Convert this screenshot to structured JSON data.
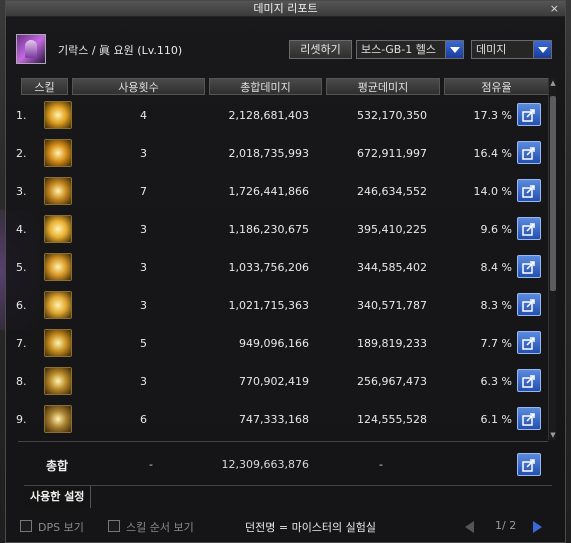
{
  "window": {
    "title": "데미지 리포트",
    "close_label": "×"
  },
  "header": {
    "character": "기락스 / 眞 요원 (Lv.110)",
    "reset_button": "리셋하기",
    "dungeon_select": "보스-GB-1 헬스",
    "metric_select": "데미지"
  },
  "columns": {
    "skill": "스킬",
    "uses": "사용횟수",
    "total": "총합데미지",
    "avg": "평균데미지",
    "share": "점유율"
  },
  "rows": [
    {
      "rank": "1.",
      "icon": "skill-icon-burst",
      "uses": "4",
      "total": "2,128,681,403",
      "avg": "532,170,350",
      "share": "17.3 %",
      "icon_color": "#e0a020"
    },
    {
      "rank": "2.",
      "icon": "skill-icon-spin",
      "uses": "3",
      "total": "2,018,735,993",
      "avg": "672,911,997",
      "share": "16.4 %",
      "icon_color": "#d89018"
    },
    {
      "rank": "3.",
      "icon": "skill-icon-blades",
      "uses": "7",
      "total": "1,726,441,866",
      "avg": "246,634,552",
      "share": "14.0 %",
      "icon_color": "#c88a20"
    },
    {
      "rank": "4.",
      "icon": "skill-icon-slash",
      "uses": "3",
      "total": "1,186,230,675",
      "avg": "395,410,225",
      "share": "9.6 %",
      "icon_color": "#e8b030"
    },
    {
      "rank": "5.",
      "icon": "skill-icon-arc",
      "uses": "3",
      "total": "1,033,756,206",
      "avg": "344,585,402",
      "share": "8.4 %",
      "icon_color": "#d89a28"
    },
    {
      "rank": "6.",
      "icon": "skill-icon-rush",
      "uses": "3",
      "total": "1,021,715,363",
      "avg": "340,571,787",
      "share": "8.3 %",
      "icon_color": "#e0a830"
    },
    {
      "rank": "7.",
      "icon": "skill-icon-target",
      "uses": "5",
      "total": "949,096,166",
      "avg": "189,819,233",
      "share": "7.7 %",
      "icon_color": "#c89020"
    },
    {
      "rank": "8.",
      "icon": "skill-icon-star",
      "uses": "3",
      "total": "770,902,419",
      "avg": "256,967,473",
      "share": "6.3 %",
      "icon_color": "#b88a28"
    },
    {
      "rank": "9.",
      "icon": "skill-icon-cross",
      "uses": "6",
      "total": "747,333,168",
      "avg": "124,555,528",
      "share": "6.1 %",
      "icon_color": "#a88030"
    }
  ],
  "total": {
    "label": "총합",
    "uses": "-",
    "sum": "12,309,663,876",
    "avg": "-"
  },
  "tab": {
    "label": "사용한 설정"
  },
  "footer": {
    "dps_label": "DPS 보기",
    "order_label": "스킬 순서 보기",
    "dungeon_name": "던전명 = 마이스터의 실험실",
    "page": "1/ 2"
  }
}
